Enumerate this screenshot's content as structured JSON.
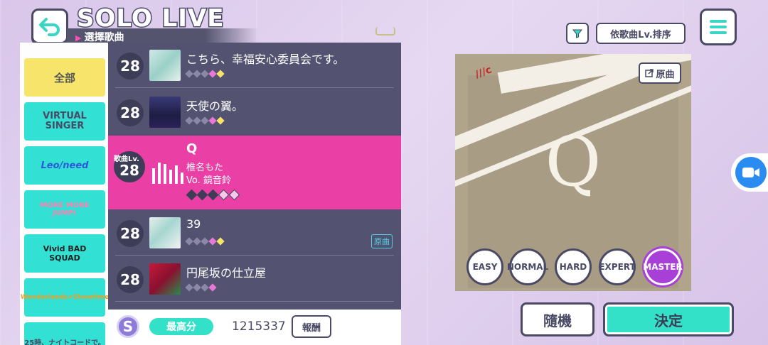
{
  "header": {
    "title": "SOLO LIVE",
    "subtitle": "選擇歌曲"
  },
  "sidebar": {
    "items": [
      {
        "label": "全部"
      },
      {
        "label": "VIRTUAL SINGER"
      },
      {
        "label": "Leo/need"
      },
      {
        "label": "MORE MORE JUMP!"
      },
      {
        "label": "Vivid BAD SQUAD"
      },
      {
        "label": "Wonderlands×Showtime"
      },
      {
        "label": "25時、ナイトコードで。"
      }
    ]
  },
  "songs": [
    {
      "level": "28",
      "title": "こちら、幸福安心委員会です。"
    },
    {
      "level": "28",
      "title": "天使の翼。"
    },
    {
      "level": "28",
      "title": "39",
      "tag": "原曲"
    },
    {
      "level": "28",
      "title": "円尾坂の仕立屋"
    }
  ],
  "selected": {
    "level_label": "歌曲Lv.",
    "level": "28",
    "title": "Q",
    "artist": "椎名もた",
    "vocal": "Vo. 鏡音鈴"
  },
  "bottom": {
    "rank": "S",
    "best_label": "最高分",
    "score": "1215337",
    "reward_label": "報酬"
  },
  "controls": {
    "sort_label": "依歌曲Lv.排序",
    "original_label": "原曲",
    "random_label": "隨機",
    "decide_label": "決定"
  },
  "jacket": {
    "letter": "Q"
  },
  "difficulties": [
    "EASY",
    "NORMAL",
    "HARD",
    "EXPERT",
    "MASTER"
  ],
  "selected_difficulty": "MASTER",
  "colors": {
    "accent_pink": "#ea3fa4",
    "accent_teal": "#33e0c8",
    "master_purple": "#a840d8",
    "list_bg": "#535270"
  }
}
